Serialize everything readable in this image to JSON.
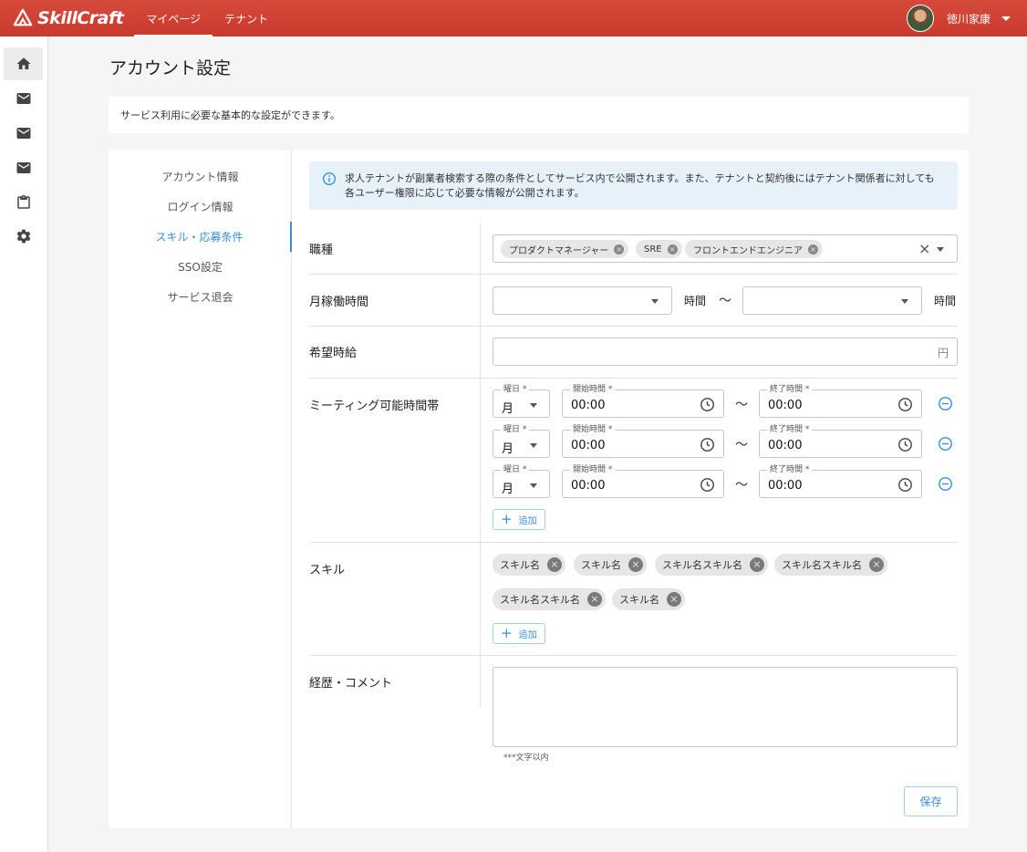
{
  "app": {
    "logo_text": "SkillCraft",
    "nav": [
      "マイページ",
      "テナント"
    ],
    "active_nav": 0,
    "user_name": "徳川家康"
  },
  "rail": [
    "home-icon",
    "mail-icon",
    "mail-icon",
    "mail-icon",
    "clipboard-icon",
    "gear-icon"
  ],
  "page": {
    "title": "アカウント設定",
    "description": "サービス利用に必要な基本的な設定ができます。"
  },
  "side_nav": {
    "items": [
      "アカウント情報",
      "ログイン情報",
      "スキル・応募条件",
      "SSO設定",
      "サービス退会"
    ],
    "active": 2
  },
  "info": {
    "line1": "求人テナントが副業者検索する際の条件としてサービス内で公開されます。また、テナントと契約後にはテナント関係者に対しても",
    "line2": "各ユーザー権限に応じて必要な情報が公開されます。"
  },
  "job": {
    "label": "職種",
    "chips": [
      "プロダクトマネージャー",
      "SRE",
      "フロントエンドエンジニア"
    ]
  },
  "hours": {
    "label": "月稼働時間",
    "from": "",
    "to": "",
    "unit": "時間",
    "tilde": "〜"
  },
  "wage": {
    "label": "希望時給",
    "value": "",
    "unit": "円"
  },
  "meeting": {
    "label": "ミーティング可能時間帯",
    "day_label": "曜日 *",
    "start_label": "開始時間 *",
    "end_label": "終了時間 *",
    "tilde": "〜",
    "rows": [
      {
        "day": "月",
        "start": "00:00",
        "end": "00:00"
      },
      {
        "day": "月",
        "start": "00:00",
        "end": "00:00"
      },
      {
        "day": "月",
        "start": "00:00",
        "end": "00:00"
      }
    ],
    "add_label": "追加"
  },
  "skills": {
    "label": "スキル",
    "chips": [
      "スキル名",
      "スキル名",
      "スキル名スキル名",
      "スキル名スキル名",
      "スキル名スキル名",
      "スキル名"
    ],
    "add_label": "追加"
  },
  "comment": {
    "label": "経歴・コメント",
    "value": "",
    "hint": "***文字以内"
  },
  "save_label": "保存",
  "colors": {
    "header": "#c83a2d",
    "accent": "#3b8ed8",
    "info_bg": "#e6f1fa"
  }
}
